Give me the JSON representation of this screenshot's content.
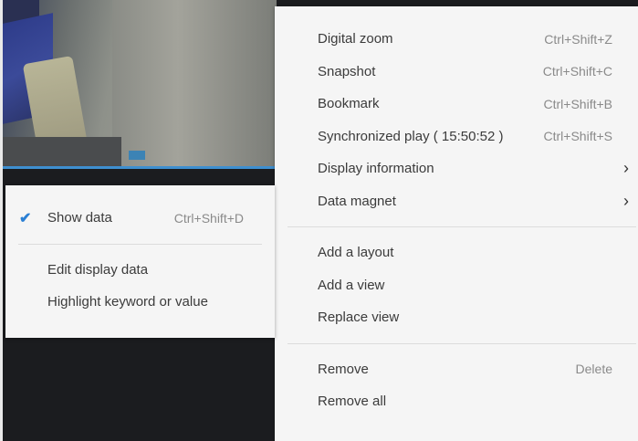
{
  "main_menu": {
    "items": [
      {
        "label": "Digital zoom",
        "shortcut": "Ctrl+Shift+Z"
      },
      {
        "label": "Snapshot",
        "shortcut": "Ctrl+Shift+C"
      },
      {
        "label": "Bookmark",
        "shortcut": "Ctrl+Shift+B"
      },
      {
        "label": "Synchronized play ( 15:50:52 )",
        "shortcut": "Ctrl+Shift+S"
      },
      {
        "label": "Display information",
        "icon": "chevron-right-icon"
      },
      {
        "label": "Data magnet",
        "icon": "chevron-right-icon"
      },
      {
        "label": "Add a layout"
      },
      {
        "label": "Add a view"
      },
      {
        "label": "Replace view"
      },
      {
        "label": "Remove",
        "shortcut": "Delete"
      },
      {
        "label": "Remove all"
      }
    ]
  },
  "sub_menu": {
    "items": [
      {
        "label": "Show data",
        "shortcut": "Ctrl+Shift+D",
        "checked": true,
        "icon": "checkmark-icon"
      },
      {
        "label": "Edit display data"
      },
      {
        "label": "Highlight keyword or value"
      }
    ]
  },
  "colors": {
    "accent": "#2a7fd4",
    "menu_bg": "#f5f5f5",
    "background": "#1b1c1f"
  }
}
